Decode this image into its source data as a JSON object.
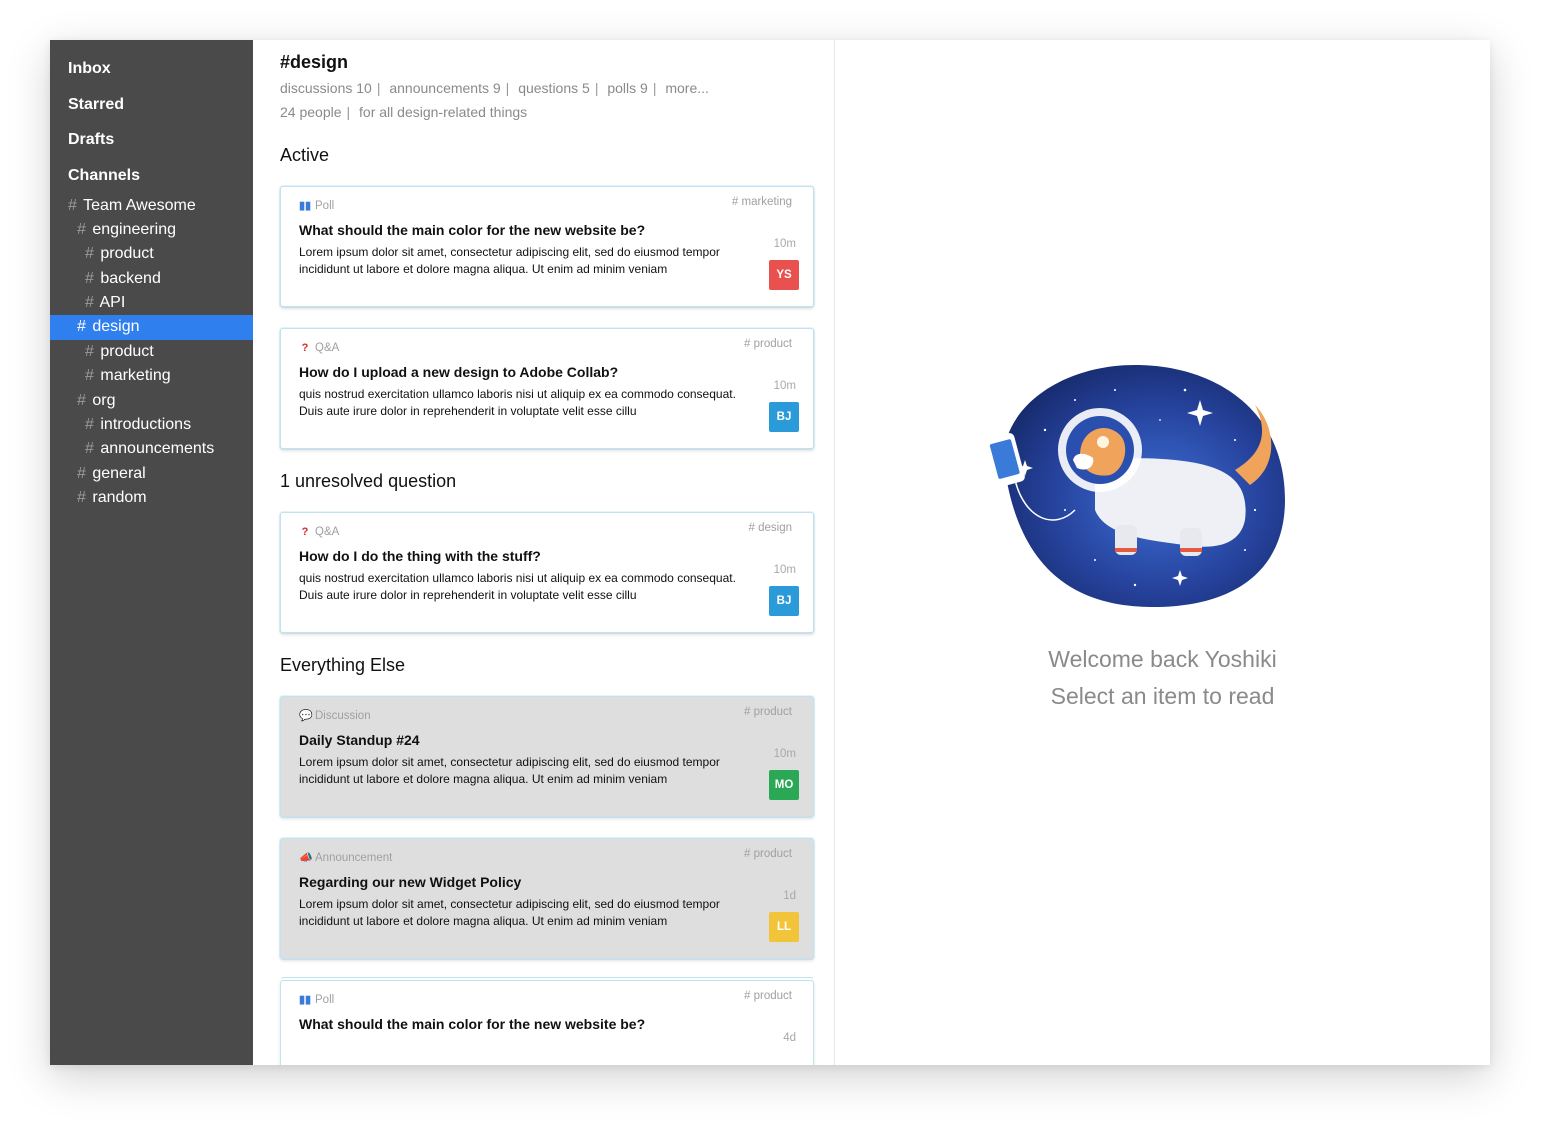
{
  "sidebar": {
    "nav": [
      "Inbox",
      "Starred",
      "Drafts"
    ],
    "channels_title": "Channels",
    "channels": [
      {
        "label": "Team Awesome",
        "level": 0,
        "active": false
      },
      {
        "label": "engineering",
        "level": 1,
        "active": false
      },
      {
        "label": "product",
        "level": 2,
        "active": false
      },
      {
        "label": "backend",
        "level": 2,
        "active": false
      },
      {
        "label": "API",
        "level": 2,
        "active": false
      },
      {
        "label": "design",
        "level": 1,
        "active": true
      },
      {
        "label": "product",
        "level": 2,
        "active": false
      },
      {
        "label": "marketing",
        "level": 2,
        "active": false
      },
      {
        "label": "org",
        "level": 1,
        "active": false
      },
      {
        "label": "introductions",
        "level": 2,
        "active": false
      },
      {
        "label": "announcements",
        "level": 2,
        "active": false
      },
      {
        "label": "general",
        "level": 1,
        "active": false
      },
      {
        "label": "random",
        "level": 1,
        "active": false
      }
    ]
  },
  "channel": {
    "title": "#design",
    "stats": [
      "discussions 10",
      "announcements 9",
      "questions 5",
      "polls 9"
    ],
    "more": "more...",
    "people": "24 people",
    "description": "for all design-related things"
  },
  "sections": [
    {
      "title": "Active",
      "cards": [
        {
          "type": "Poll",
          "icon": "poll-icon",
          "channel": "# marketing",
          "title": "What should the main color for the new website be?",
          "body": "Lorem ipsum dolor sit amet, consectetur adipiscing elit, sed do eiusmod tempor incididunt ut labore et dolore magna aliqua. Ut enim ad minim veniam",
          "time": "10m",
          "initials": "YS",
          "avatar_color": "#e8514d",
          "grey": false
        },
        {
          "type": "Q&A",
          "icon": "question-icon",
          "channel": "# product",
          "title": "How do I upload a new design to Adobe Collab?",
          "body": "quis nostrud exercitation ullamco laboris nisi ut aliquip ex ea commodo consequat. Duis aute irure dolor in reprehenderit in voluptate velit esse cillu",
          "time": "10m",
          "initials": "BJ",
          "avatar_color": "#2a9bd8",
          "grey": false
        }
      ]
    },
    {
      "title": "1 unresolved question",
      "cards": [
        {
          "type": "Q&A",
          "icon": "question-icon",
          "channel": "# design",
          "title": "How do I do the thing with the stuff?",
          "body": "quis nostrud exercitation ullamco laboris nisi ut aliquip ex ea commodo consequat. Duis aute irure dolor in reprehenderit in voluptate velit esse cillu",
          "time": "10m",
          "initials": "BJ",
          "avatar_color": "#2a9bd8",
          "grey": false
        }
      ]
    },
    {
      "title": "Everything Else",
      "cards": [
        {
          "type": "Discussion",
          "icon": "discussion-icon",
          "channel": "# product",
          "title": "Daily Standup #24",
          "body": "Lorem ipsum dolor sit amet, consectetur adipiscing elit, sed do eiusmod tempor incididunt ut labore et dolore magna aliqua. Ut enim ad minim veniam",
          "time": "10m",
          "initials": "MO",
          "avatar_color": "#2aa856",
          "grey": true
        },
        {
          "type": "Announcement",
          "icon": "announcement-icon",
          "channel": "# product",
          "title": "Regarding our new Widget Policy",
          "body": "Lorem ipsum dolor sit amet, consectetur adipiscing elit, sed do eiusmod tempor incididunt ut labore et dolore magna aliqua. Ut enim ad minim veniam",
          "time": "1d",
          "initials": "LL",
          "avatar_color": "#f2c43a",
          "grey": true
        },
        {
          "type": "Poll",
          "icon": "poll-icon",
          "channel": "# product",
          "title": "What should the main color for the new website be?",
          "body": "",
          "time": "4d",
          "initials": "",
          "avatar_color": "#2a9bd8",
          "grey": false,
          "stack": true
        }
      ]
    }
  ],
  "welcome": {
    "line1": "Welcome back Yoshiki",
    "line2": "Select an item to read"
  }
}
